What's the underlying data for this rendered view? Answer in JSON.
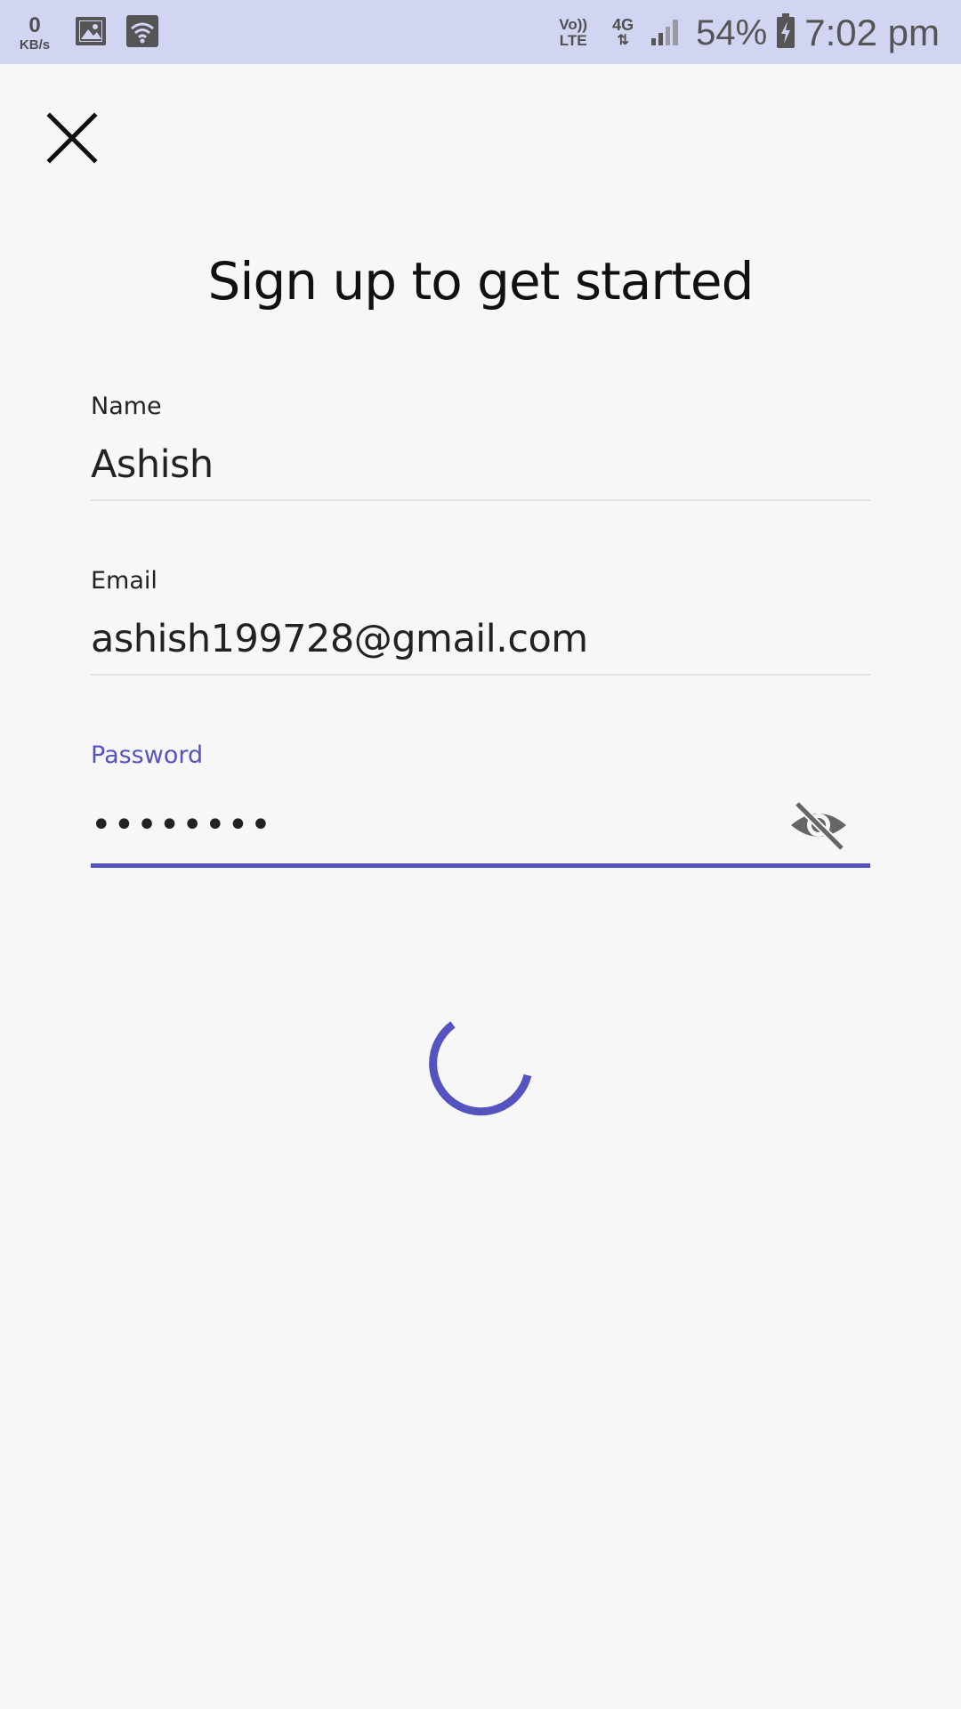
{
  "status_bar": {
    "net_speed_value": "0",
    "net_speed_unit": "KB/s",
    "volte_top": "Vo))",
    "volte_bottom": "LTE",
    "network_type": "4G",
    "battery_percent": "54%",
    "time": "7:02 pm",
    "icons": [
      "image-icon",
      "wifi-icon",
      "signal-icon",
      "battery-charging-icon"
    ]
  },
  "header": {
    "close_icon": "close-icon",
    "title": "Sign up to get started"
  },
  "form": {
    "name": {
      "label": "Name",
      "value": "Ashish"
    },
    "email": {
      "label": "Email",
      "value": "ashish199728@gmail.com"
    },
    "password": {
      "label": "Password",
      "masked_value": "••••••••",
      "toggle_icon": "eye-off-icon",
      "focused": true
    }
  },
  "colors": {
    "accent": "#5553c0",
    "status_bar_bg": "#d2d5f1",
    "background": "#f7f7f7"
  },
  "loading": {
    "icon": "loading-spinner-icon"
  }
}
